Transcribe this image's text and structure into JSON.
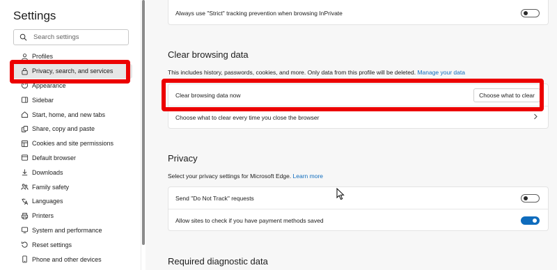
{
  "sidebar": {
    "title": "Settings",
    "search_placeholder": "Search settings",
    "items": [
      {
        "label": "Profiles",
        "icon": "profile-icon"
      },
      {
        "label": "Privacy, search, and services",
        "icon": "lock-icon"
      },
      {
        "label": "Appearance",
        "icon": "appearance-icon"
      },
      {
        "label": "Sidebar",
        "icon": "sidebar-icon"
      },
      {
        "label": "Start, home, and new tabs",
        "icon": "home-icon"
      },
      {
        "label": "Share, copy and paste",
        "icon": "share-icon"
      },
      {
        "label": "Cookies and site permissions",
        "icon": "cookie-icon"
      },
      {
        "label": "Default browser",
        "icon": "browser-icon"
      },
      {
        "label": "Downloads",
        "icon": "download-icon"
      },
      {
        "label": "Family safety",
        "icon": "family-icon"
      },
      {
        "label": "Languages",
        "icon": "language-icon"
      },
      {
        "label": "Printers",
        "icon": "printer-icon"
      },
      {
        "label": "System and performance",
        "icon": "system-icon"
      },
      {
        "label": "Reset settings",
        "icon": "reset-icon"
      },
      {
        "label": "Phone and other devices",
        "icon": "phone-icon"
      }
    ],
    "active_index": 1
  },
  "main": {
    "inprivate_row": {
      "label": "Always use \"Strict\" tracking prevention when browsing InPrivate",
      "toggle_on": false
    },
    "clear_browsing": {
      "title": "Clear browsing data",
      "description": "This includes history, passwords, cookies, and more. Only data from this profile will be deleted.",
      "manage_link": "Manage your data",
      "clear_now_label": "Clear browsing data now",
      "clear_button": "Choose what to clear",
      "close_browser_label": "Choose what to clear every time you close the browser"
    },
    "privacy": {
      "title": "Privacy",
      "description": "Select your privacy settings for Microsoft Edge.",
      "learn_more": "Learn more",
      "dnt_label": "Send \"Do Not Track\" requests",
      "dnt_on": false,
      "payment_label": "Allow sites to check if you have payment methods saved",
      "payment_on": true
    },
    "diagnostic": {
      "title": "Required diagnostic data"
    }
  },
  "colors": {
    "accent": "#0f6cbd",
    "highlight": "#ec0000"
  }
}
